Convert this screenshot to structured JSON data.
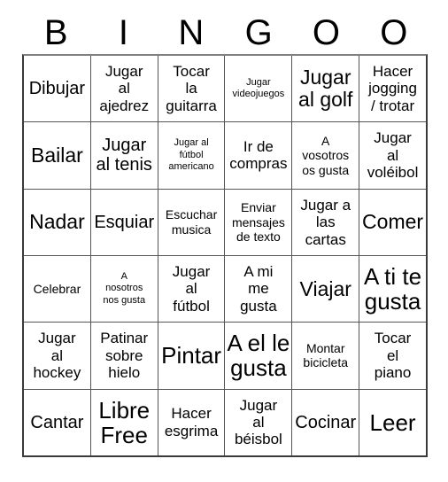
{
  "card": {
    "header_letters": [
      "B",
      "I",
      "N",
      "G",
      "O",
      "O"
    ],
    "columns": 6,
    "rows": 6,
    "border_color": "#555555",
    "text_color": "#000000",
    "background_color": "#ffffff",
    "cells": [
      [
        {
          "text": "Dibujar",
          "size": "lg"
        },
        {
          "text": "Jugar\nal\najedrez",
          "size": "md"
        },
        {
          "text": "Tocar\nla\nguitarra",
          "size": "md"
        },
        {
          "text": "Jugar\nvideojuegos",
          "size": "xs"
        },
        {
          "text": "Jugar\nal golf",
          "size": "xl"
        },
        {
          "text": "Hacer\njogging\n/ trotar",
          "size": "md"
        }
      ],
      [
        {
          "text": "Bailar",
          "size": "xl"
        },
        {
          "text": "Jugar\nal tenis",
          "size": "lg"
        },
        {
          "text": "Jugar al\nfútbol\namericano",
          "size": "xs"
        },
        {
          "text": "Ir de\ncompras",
          "size": "md"
        },
        {
          "text": "A\nvosotros\nos gusta",
          "size": "sm"
        },
        {
          "text": "Jugar\nal\nvoléibol",
          "size": "md"
        }
      ],
      [
        {
          "text": "Nadar",
          "size": "xl"
        },
        {
          "text": "Esquiar",
          "size": "lg"
        },
        {
          "text": "Escuchar\nmusica",
          "size": "sm"
        },
        {
          "text": "Enviar\nmensajes\nde texto",
          "size": "sm"
        },
        {
          "text": "Jugar a\nlas\ncartas",
          "size": "md"
        },
        {
          "text": "Comer",
          "size": "xl"
        }
      ],
      [
        {
          "text": "Celebrar",
          "size": "sm"
        },
        {
          "text": "A\nnosotros\nnos gusta",
          "size": "xs"
        },
        {
          "text": "Jugar\nal\nfútbol",
          "size": "md"
        },
        {
          "text": "A mi\nme\ngusta",
          "size": "md"
        },
        {
          "text": "Viajar",
          "size": "xl"
        },
        {
          "text": "A ti te\ngusta",
          "size": "xxl"
        }
      ],
      [
        {
          "text": "Jugar\nal\nhockey",
          "size": "md"
        },
        {
          "text": "Patinar\nsobre\nhielo",
          "size": "md"
        },
        {
          "text": "Pintar",
          "size": "xxl"
        },
        {
          "text": "A el le\ngusta",
          "size": "xxl"
        },
        {
          "text": "Montar\nbicicleta",
          "size": "sm"
        },
        {
          "text": "Tocar\nel\npiano",
          "size": "md"
        }
      ],
      [
        {
          "text": "Cantar",
          "size": "lg"
        },
        {
          "text": "Libre\nFree",
          "size": "xxl"
        },
        {
          "text": "Hacer\nesgrima",
          "size": "md"
        },
        {
          "text": "Jugar\nal\nbéisbol",
          "size": "md"
        },
        {
          "text": "Cocinar",
          "size": "lg"
        },
        {
          "text": "Leer",
          "size": "xxl"
        }
      ]
    ]
  }
}
